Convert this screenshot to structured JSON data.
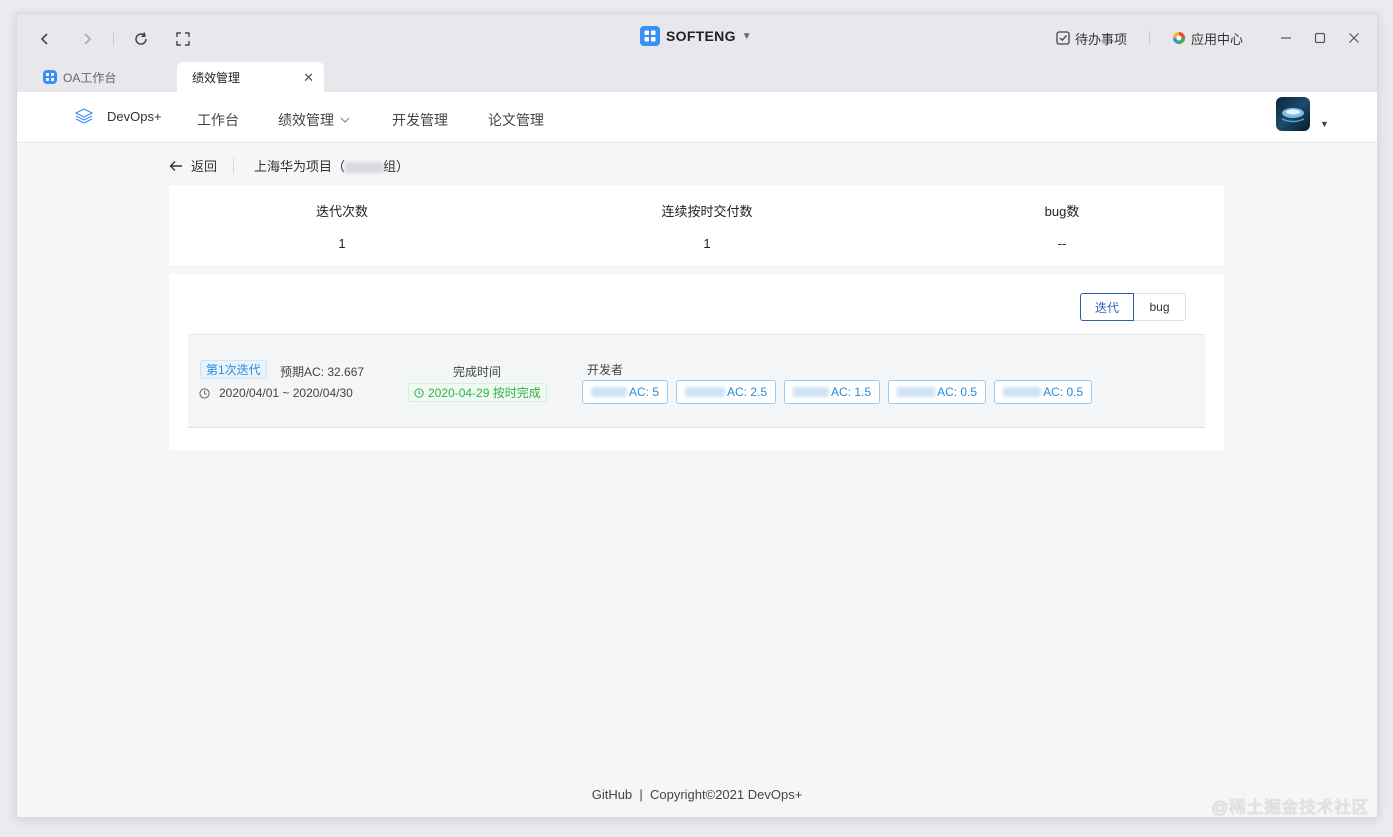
{
  "browser": {
    "app_name": "SOFTENG",
    "todo_label": "待办事项",
    "app_center_label": "应用中心",
    "tabs": [
      {
        "label": "OA工作台",
        "active": false
      },
      {
        "label": "绩效管理",
        "active": true
      }
    ]
  },
  "nav": {
    "brand": "DevOps+",
    "items": [
      "工作台",
      "绩效管理",
      "开发管理",
      "论文管理"
    ]
  },
  "breadcrumb": {
    "back_label": "返回",
    "project_prefix": "上海华为项目（",
    "project_suffix": "组）"
  },
  "stats": [
    {
      "label": "迭代次数",
      "value": "1"
    },
    {
      "label": "连续按时交付数",
      "value": "1"
    },
    {
      "label": "bug数",
      "value": "--"
    }
  ],
  "toggle": {
    "options": [
      "迭代",
      "bug"
    ],
    "selected": "迭代"
  },
  "iteration": {
    "tag": "第1次迭代",
    "expected_ac": "预期AC: 32.667",
    "date_range": "2020/04/01 ~ 2020/04/30",
    "finish_label": "完成时间",
    "finish_status": "2020-04-29 按时完成",
    "developers_label": "开发者",
    "developers": [
      {
        "ac": "AC: 5"
      },
      {
        "ac": "AC: 2.5"
      },
      {
        "ac": "AC: 1.5"
      },
      {
        "ac": "AC: 0.5"
      },
      {
        "ac": "AC: 0.5"
      }
    ]
  },
  "footer": {
    "text": "GitHub  |  Copyright©2021 DevOps+"
  },
  "watermark": "@稀土掘金技术社区",
  "colors": {
    "accent": "#2b8ad8",
    "success": "#31b052",
    "brand_blue": "#3b8ef5"
  }
}
